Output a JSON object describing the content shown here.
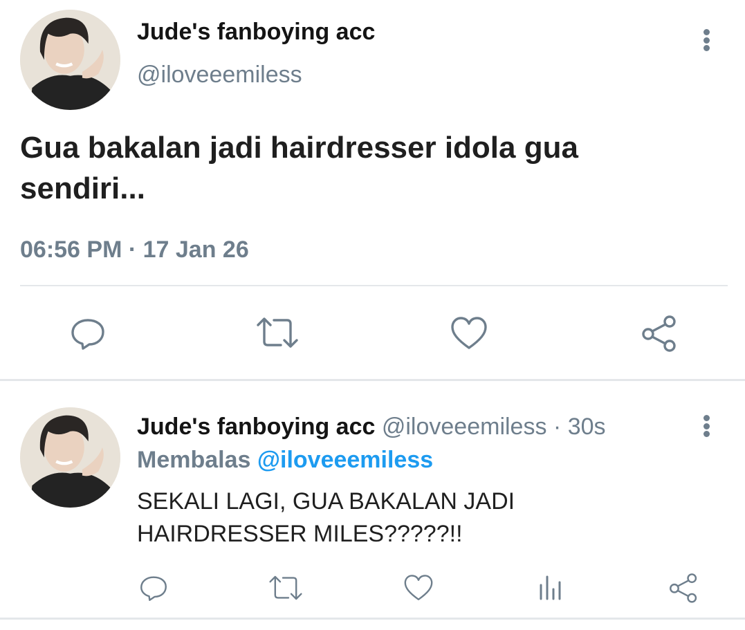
{
  "main_tweet": {
    "display_name": "Jude's fanboying acc",
    "handle": "@iloveeemiless",
    "text_line1": "Gua bakalan jadi hairdresser idola gua",
    "text_line2": "sendiri...",
    "timestamp": "06:56 PM · 17 Jan 26",
    "actions": [
      "reply-icon",
      "retweet-icon",
      "like-icon",
      "share-icon"
    ]
  },
  "reply_tweet": {
    "display_name": "Jude's fanboying acc",
    "handle": "@iloveeemiless",
    "separator": "·",
    "time_ago": "30s",
    "replying_label": "Membalas",
    "replying_handle": "@iloveeemiless",
    "text_line1": "SEKALI LAGI, GUA BAKALAN JADI",
    "text_line2": "HAIRDRESSER MILES?????!!",
    "actions": [
      "reply-icon",
      "retweet-icon",
      "like-icon",
      "views-icon",
      "share-icon"
    ]
  },
  "colors": {
    "icon_gray": "#6e7e8c",
    "link_blue": "#1d9bf0",
    "divider": "#e4e7ea"
  }
}
